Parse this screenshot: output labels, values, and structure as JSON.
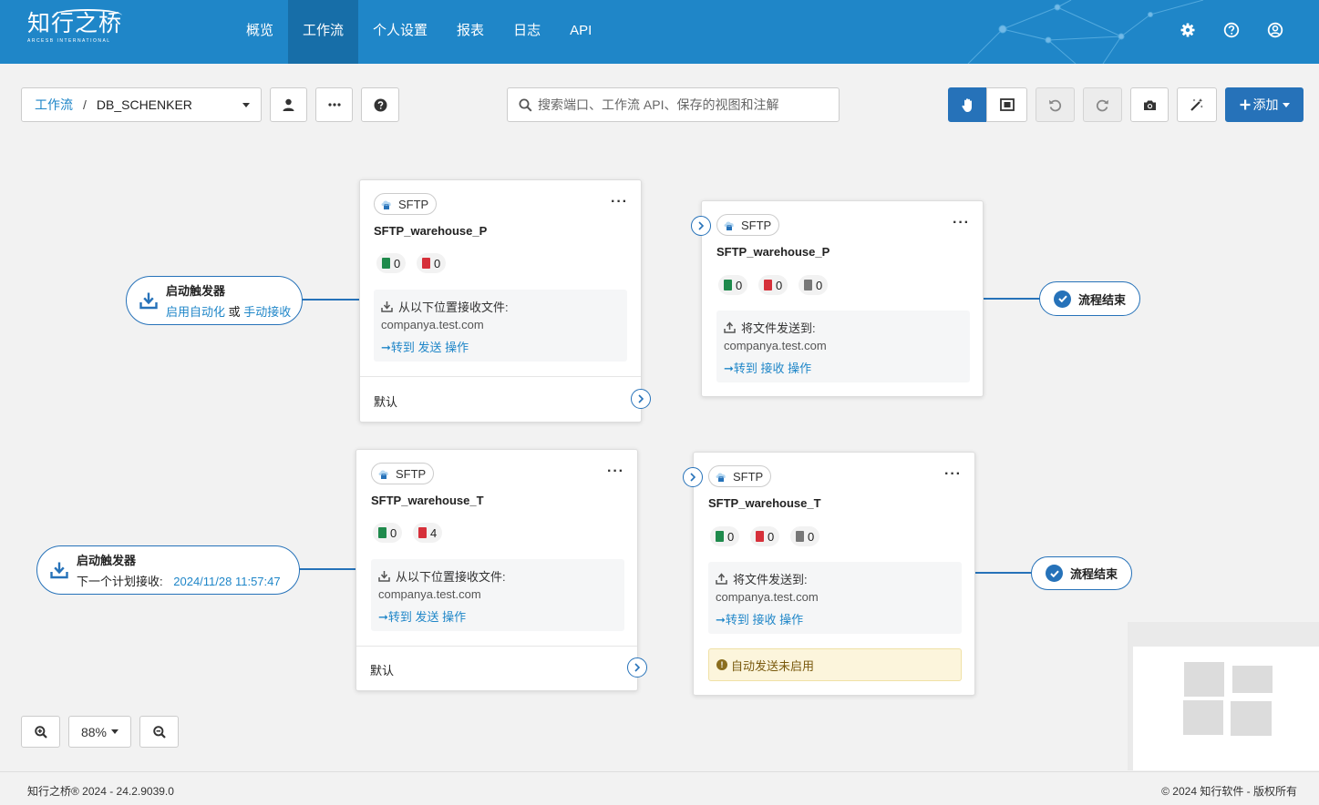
{
  "app": {
    "logo_cn": "知行之桥",
    "logo_en": "ARCESB INTERNATIONAL"
  },
  "nav": {
    "items": [
      "概览",
      "工作流",
      "个人设置",
      "报表",
      "日志",
      "API"
    ],
    "active_index": 1
  },
  "header_icons": [
    "gear-icon",
    "help-icon",
    "user-icon"
  ],
  "toolbar": {
    "breadcrumb_link": "工作流",
    "breadcrumb_sep": "/",
    "breadcrumb_current": "DB_SCHENKER",
    "search_placeholder": "搜索端口、工作流 API、保存的视图和注解",
    "add_label": "添加"
  },
  "flow1": {
    "trigger": {
      "title": "启动触发器",
      "sub_link1": "启用自动化",
      "sub_or": "或",
      "sub_link2": "手动接收"
    },
    "card_a": {
      "tag": "SFTP",
      "name": "SFTP_warehouse_P",
      "counts": [
        "0",
        "0"
      ],
      "box_title": "从以下位置接收文件:",
      "host": "companya.test.com",
      "goto": "转到 发送 操作",
      "footer": "默认"
    },
    "card_b": {
      "tag": "SFTP",
      "name": "SFTP_warehouse_P",
      "counts": [
        "0",
        "0",
        "0"
      ],
      "box_title": "将文件发送到:",
      "host": "companya.test.com",
      "goto": "转到 接收 操作"
    },
    "end": "流程结束"
  },
  "flow2": {
    "trigger": {
      "title": "启动触发器",
      "sub_label": "下一个计划接收:",
      "sub_time": "2024/11/28 11:57:47"
    },
    "card_a": {
      "tag": "SFTP",
      "name": "SFTP_warehouse_T",
      "counts": [
        "0",
        "4"
      ],
      "box_title": "从以下位置接收文件:",
      "host": "companya.test.com",
      "goto": "转到 发送 操作",
      "footer": "默认"
    },
    "card_b": {
      "tag": "SFTP",
      "name": "SFTP_warehouse_T",
      "counts": [
        "0",
        "0",
        "0"
      ],
      "box_title": "将文件发送到:",
      "host": "companya.test.com",
      "goto": "转到 接收 操作",
      "warning": "自动发送未启用"
    },
    "end": "流程结束"
  },
  "zoom": {
    "level": "88%"
  },
  "footer": {
    "left": "知行之桥® 2024 - 24.2.9039.0",
    "right": "© 2024 知行软件 - 版权所有"
  },
  "colors": {
    "header": "#1f86c8",
    "accent": "#2672b9",
    "success": "#1f8a4c",
    "danger": "#d6303a",
    "warning_bg": "#fcf5dc"
  }
}
